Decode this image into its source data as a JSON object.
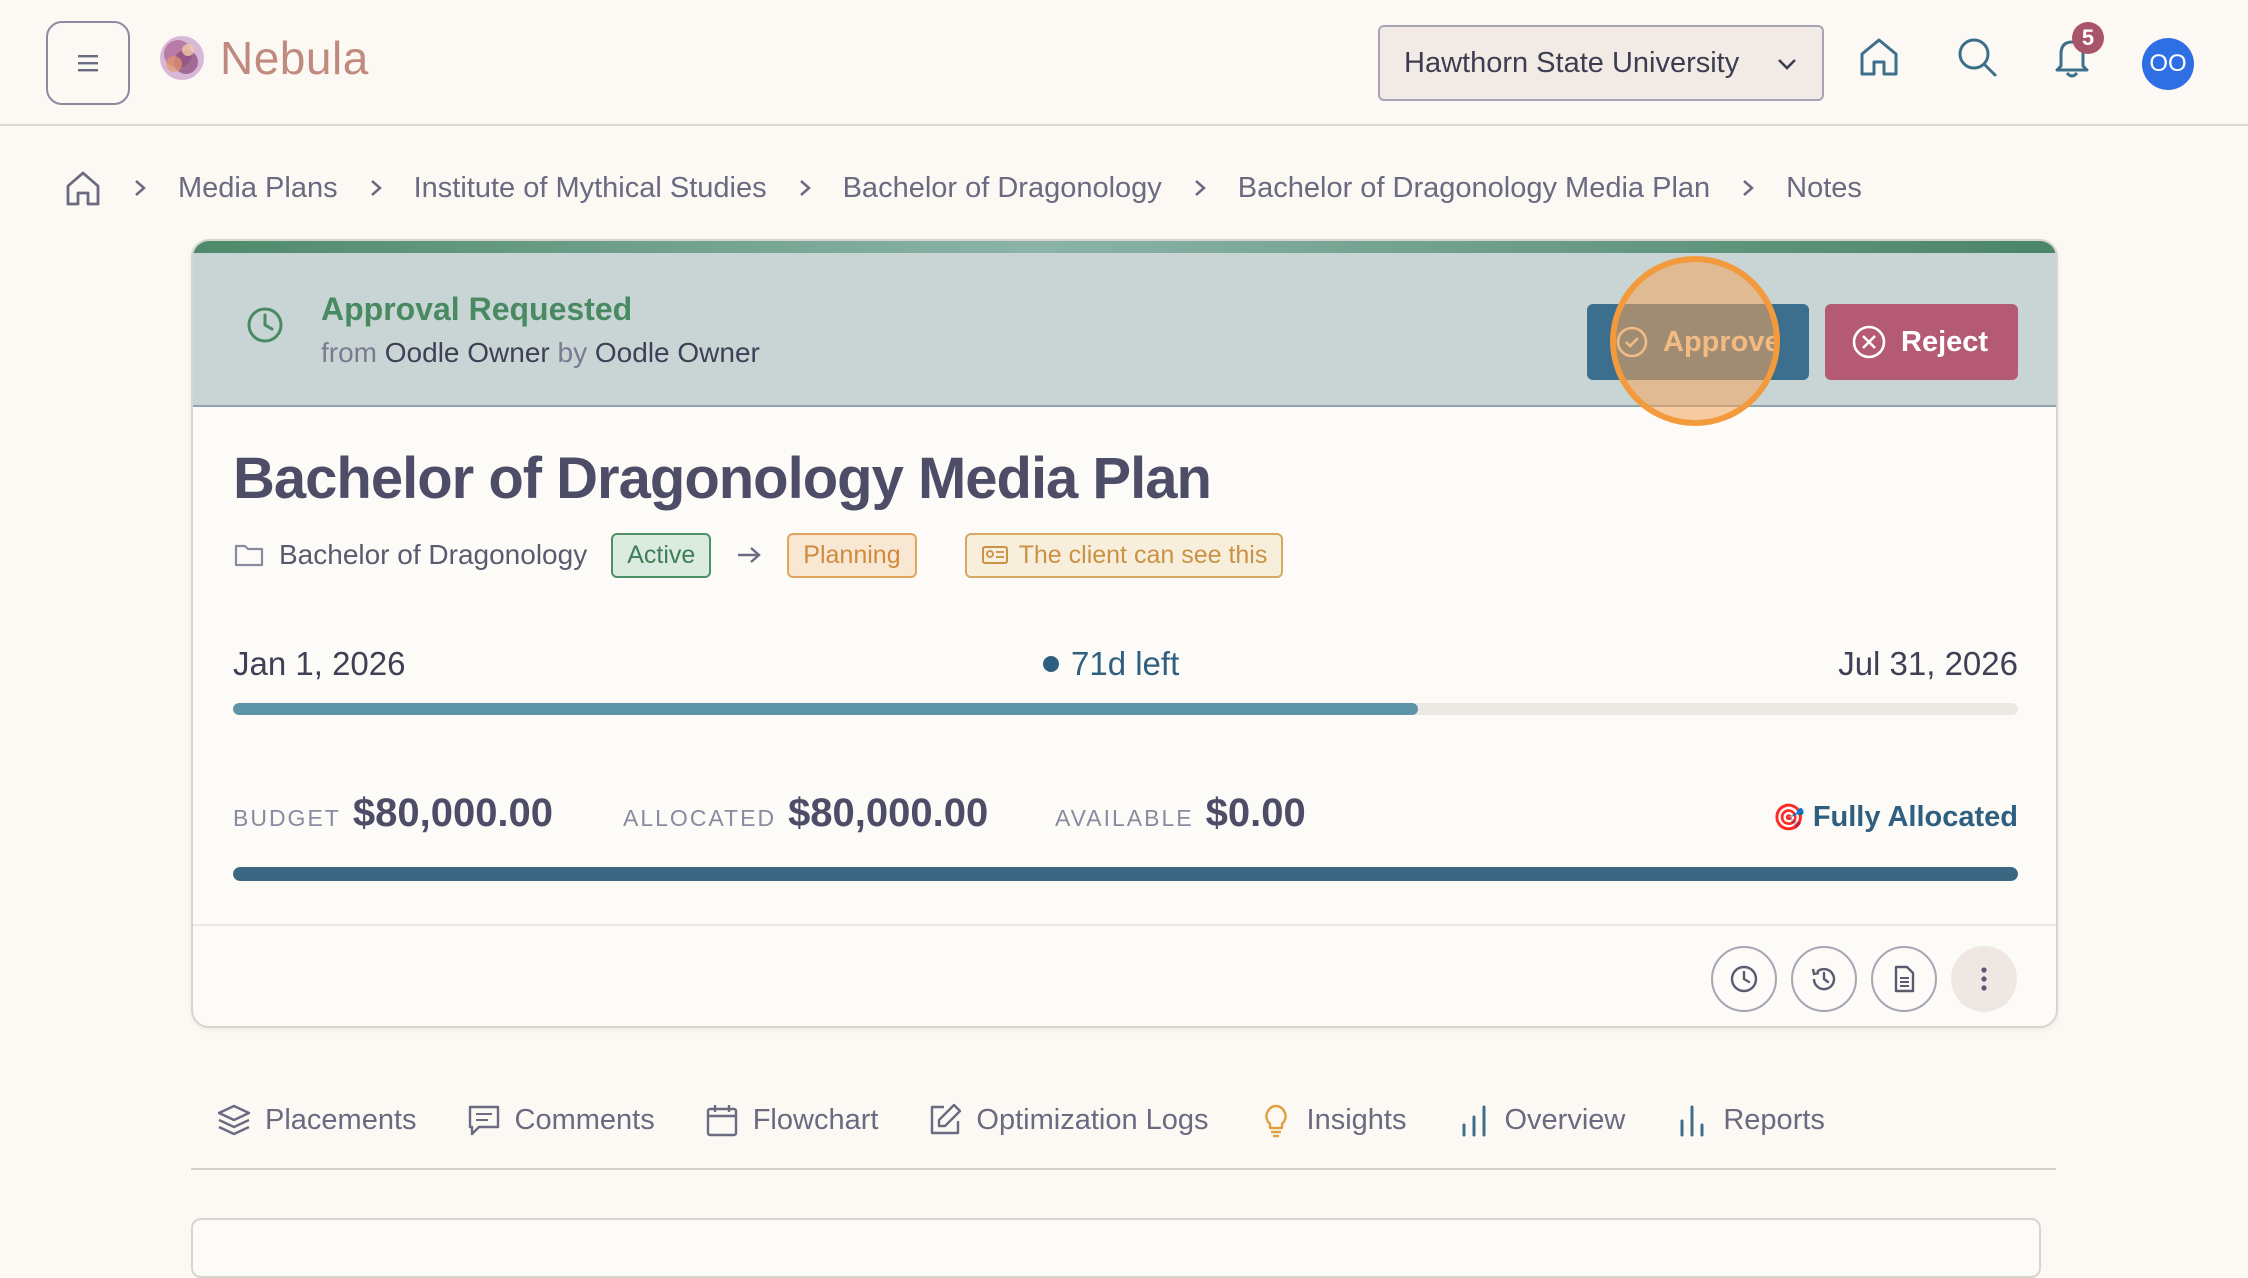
{
  "header": {
    "app_name": "Nebula",
    "org_selector": "Hawthorn State University",
    "notification_count": "5",
    "avatar_initials": "OO",
    "icons": [
      "menu-icon",
      "home-icon",
      "search-icon",
      "bell-icon"
    ]
  },
  "breadcrumb": {
    "items": [
      "Media Plans",
      "Institute of Mythical Studies",
      "Bachelor of Dragonology",
      "Bachelor of Dragonology Media Plan",
      "Notes"
    ]
  },
  "approval": {
    "title": "Approval Requested",
    "from_prefix": "from",
    "from_name": "Oodle Owner",
    "by_prefix": "by",
    "by_name": "Oodle Owner",
    "approve_label": "Approve",
    "reject_label": "Reject"
  },
  "plan": {
    "title": "Bachelor of Dragonology Media Plan",
    "program": "Bachelor of Dragonology",
    "status_from": "Active",
    "status_to": "Planning",
    "visibility": "The client can see this",
    "start_date": "Jan 1, 2026",
    "end_date": "Jul 31, 2026",
    "days_left": "71d left",
    "time_elapsed_fraction": 0.664
  },
  "budget": {
    "budget_label": "BUDGET",
    "budget_value": "$80,000.00",
    "allocated_label": "ALLOCATED",
    "allocated_value": "$80,000.00",
    "available_label": "AVAILABLE",
    "available_value": "$0.00",
    "status": "Fully Allocated",
    "allocated_fraction": 1.0
  },
  "tabs": [
    "Placements",
    "Comments",
    "Flowchart",
    "Optimization Logs",
    "Insights",
    "Overview",
    "Reports"
  ],
  "colors": {
    "approve": "#3c6e8e",
    "reject": "#b45a74",
    "accent_green": "#4a8a62",
    "highlight": "#f39a3c"
  }
}
